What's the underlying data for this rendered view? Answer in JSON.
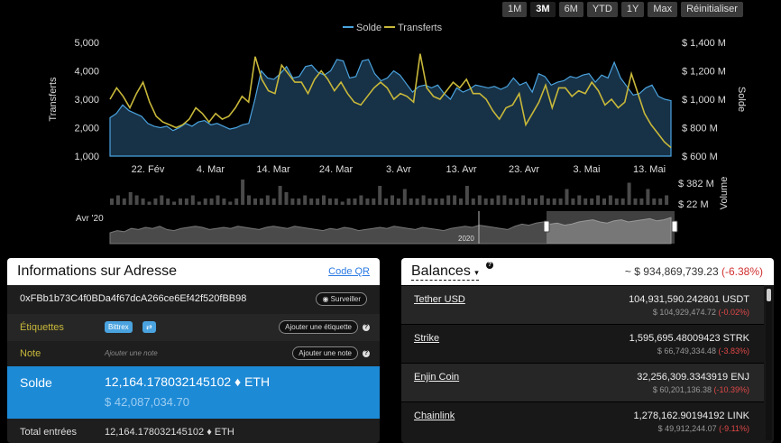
{
  "range": {
    "buttons": [
      "1M",
      "3M",
      "6M",
      "YTD",
      "1Y",
      "Max"
    ],
    "active": "3M",
    "reset_label": "Réinitialiser"
  },
  "chart_data": {
    "type": "area",
    "legend": [
      "Solde",
      "Transferts"
    ],
    "legend_placement": "top-center",
    "x_ticks": [
      "22. Fév",
      "4. Mar",
      "14. Mar",
      "24. Mar",
      "3. Avr",
      "13. Avr",
      "23. Avr",
      "3. Mai",
      "13. Mai"
    ],
    "yleft": {
      "label": "Transferts",
      "ticks": [
        "5,000",
        "4,000",
        "3,000",
        "2,000",
        "1,000"
      ],
      "range": [
        1000,
        5000
      ]
    },
    "yright": {
      "label": "Solde",
      "ticks": [
        "$ 1,400 M",
        "$ 1,200 M",
        "$ 1,000 M",
        "$ 800 M",
        "$ 600 M"
      ],
      "range": [
        600,
        1400
      ]
    },
    "volume": {
      "label": "Volume",
      "ticks": [
        "$ 382 M",
        "$ 22 M"
      ]
    },
    "navigator": {
      "start_label": "Avr '20",
      "mid_label": "2020"
    },
    "series": [
      {
        "name": "Solde",
        "color": "#4aa3df",
        "values": [
          870,
          900,
          960,
          920,
          900,
          880,
          830,
          810,
          800,
          810,
          780,
          800,
          830,
          810,
          840,
          850,
          820,
          830,
          810,
          790,
          800,
          820,
          830,
          1000,
          1200,
          1150,
          1140,
          1180,
          1230,
          1150,
          1160,
          1230,
          1240,
          1190,
          1170,
          1200,
          1280,
          1270,
          1150,
          1160,
          1270,
          1280,
          1180,
          1130,
          1150,
          1200,
          1170,
          1110,
          1050,
          1090,
          1100,
          1080,
          1100,
          1040,
          1000,
          1080,
          1050,
          1070,
          1100,
          1090,
          1080,
          1090,
          1070,
          1090,
          1150,
          1100,
          1120,
          1050,
          1180,
          1160,
          1100,
          1120,
          1130,
          1160,
          1150,
          1170,
          1180,
          1120,
          1170,
          1150,
          1260,
          1150,
          1090,
          1030,
          1040,
          1080,
          1100,
          1020,
          1000,
          990
        ]
      },
      {
        "name": "Transferts",
        "color": "#c8b83a",
        "values": [
          3000,
          3400,
          3100,
          2700,
          3200,
          3600,
          2900,
          2400,
          2200,
          2100,
          2000,
          2100,
          2300,
          2700,
          2500,
          2200,
          2500,
          2300,
          2400,
          2700,
          3100,
          2900,
          4500,
          3700,
          3300,
          3200,
          4200,
          3900,
          3600,
          3600,
          3200,
          3700,
          4000,
          3700,
          3300,
          3600,
          3200,
          2900,
          2800,
          3100,
          3400,
          3600,
          3400,
          3000,
          3200,
          3100,
          2900,
          4600,
          3400,
          3100,
          3000,
          3300,
          3600,
          3400,
          3700,
          3200,
          3200,
          3000,
          2600,
          2300,
          2700,
          2800,
          3200,
          2100,
          2500,
          2900,
          3500,
          2700,
          3400,
          3400,
          3100,
          3300,
          3200,
          3600,
          3300,
          2800,
          3000,
          2700,
          2900,
          3900,
          3200,
          2500,
          2100,
          1800,
          1500,
          1300
        ]
      }
    ],
    "volume_values": [
      2,
      3,
      2,
      4,
      3,
      2,
      1,
      2,
      3,
      2,
      1,
      2,
      2,
      3,
      1,
      2,
      2,
      3,
      2,
      1,
      2,
      8,
      3,
      2,
      2,
      3,
      2,
      6,
      4,
      2,
      2,
      3,
      2,
      2,
      3,
      2,
      2,
      1,
      2,
      2,
      3,
      2,
      2,
      6,
      2,
      3,
      2,
      5,
      2,
      2,
      3,
      2,
      2,
      2,
      3,
      3,
      2,
      6,
      2,
      3,
      2,
      2,
      3,
      3,
      2,
      2,
      3,
      2,
      2,
      3,
      2,
      2,
      2,
      5,
      2,
      3,
      2,
      2,
      3,
      2,
      3,
      2,
      2,
      7,
      2,
      2,
      5,
      2,
      2,
      3
    ],
    "navigator_values": [
      10,
      12,
      11,
      14,
      13,
      15,
      14,
      16,
      13,
      12,
      14,
      15,
      16,
      15,
      13,
      14,
      15,
      14,
      16,
      15,
      14,
      13,
      15,
      16,
      15,
      14,
      16,
      15,
      14,
      13,
      12,
      14,
      13,
      15,
      14,
      12,
      13,
      14,
      15,
      14,
      16,
      15,
      14,
      13,
      15,
      14,
      13,
      12,
      14,
      15,
      16,
      15,
      17,
      16,
      15,
      14,
      13,
      16,
      18,
      17,
      19,
      20,
      18,
      19,
      17,
      18,
      20,
      21,
      22,
      20,
      19,
      21,
      22,
      20,
      21,
      22,
      23,
      21,
      22,
      24
    ]
  },
  "info": {
    "title": "Informations sur Adresse",
    "qr_link": "Code QR",
    "address": "0xFBb1b73C4f0BDa4f67dcA266ce6Ef42f520fBB98",
    "watch_label": "Surveiller",
    "tags_label": "Étiquettes",
    "tag": "Bittrex",
    "tag_swap": "⇄",
    "add_tag": "Ajouter une étiquette",
    "note_label": "Note",
    "note_placeholder": "Ajouter une note",
    "add_note": "Ajouter une note",
    "solde_label": "Solde",
    "solde_eth": "12,164.178032145102",
    "eth_symbol": "♦ ETH",
    "solde_usd": "$ 42,087,034.70",
    "total_label": "Total entrées",
    "total_value": "12,164.178032145102",
    "total_symbol": "♦ ETH"
  },
  "balances": {
    "title": "Balances",
    "total": "~ $ 934,869,739.23",
    "change": "(-6.38%)",
    "items": [
      {
        "name": "Tether USD",
        "amount": "104,931,590.242801 USDT",
        "usd": "$ 104,929,474.72",
        "change": "(-0.02%)"
      },
      {
        "name": "Strike",
        "amount": "1,595,695.48009423 STRK",
        "usd": "$ 66,749,334.48",
        "change": "(-3.83%)"
      },
      {
        "name": "Enjin Coin",
        "amount": "32,256,309.3343919 ENJ",
        "usd": "$ 60,201,136.38",
        "change": "(-10.39%)"
      },
      {
        "name": "Chainlink",
        "amount": "1,278,162.90194192 LINK",
        "usd": "$ 49,912,244.07",
        "change": "(-9.11%)"
      }
    ]
  }
}
